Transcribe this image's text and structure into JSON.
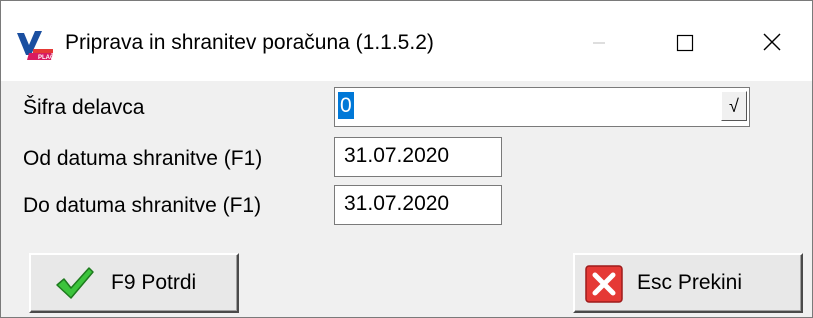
{
  "window": {
    "title": "Priprava in shranitev poračuna  (1.1.5.2)"
  },
  "form": {
    "employee_code_label": "Šifra delavca",
    "employee_code_value": "0",
    "date_from_label": "Od datuma shranitve (F1)",
    "date_from_value": "31.07.2020",
    "date_to_label": "Do datuma shranitve (F1)",
    "date_to_value": "31.07.2020",
    "dropdown_glyph": "√"
  },
  "buttons": {
    "confirm_label": "F9 Potrdi",
    "cancel_label": "Esc Prekini"
  },
  "icons": {
    "app": "app-logo-icon",
    "minimize": "minimize-icon",
    "maximize": "maximize-icon",
    "close": "close-icon",
    "confirm": "checkmark-icon",
    "cancel": "red-x-icon"
  }
}
